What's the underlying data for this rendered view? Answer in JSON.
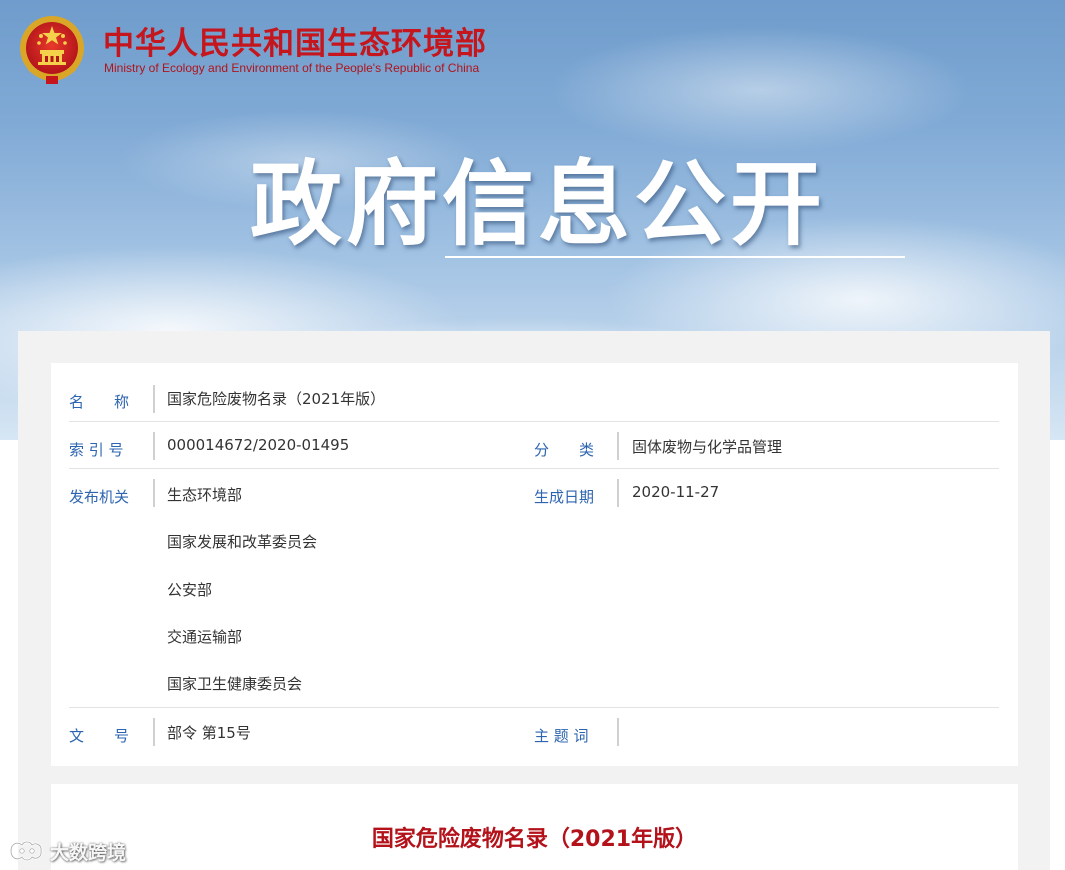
{
  "header": {
    "ministry_name_cn": "中华人民共和国生态环境部",
    "ministry_name_en": "Ministry of Ecology and Environment of the People's Republic of China",
    "page_title": "政府信息公开"
  },
  "info": {
    "name_label": "名　　称",
    "name_value": "国家危险废物名录（2021年版）",
    "index_label": "索 引 号",
    "index_value": "000014672/2020-01495",
    "category_label": "分　　类",
    "category_value": "固体废物与化学品管理",
    "issuer_label": "发布机关",
    "issuers": [
      "生态环境部",
      "国家发展和改革委员会",
      "公安部",
      "交通运输部",
      "国家卫生健康委员会"
    ],
    "date_label": "生成日期",
    "date_value": "2020-11-27",
    "doc_no_label": "文　　号",
    "doc_no_value": "部令 第15号",
    "subject_label": "主 题 词",
    "subject_value": ""
  },
  "document": {
    "title": "国家危险废物名录（2021年版）"
  },
  "watermark": {
    "text": "大数跨境"
  },
  "colors": {
    "brand_red": "#c4161c",
    "label_blue": "#2c64b0",
    "doc_title_red": "#b3121b"
  }
}
